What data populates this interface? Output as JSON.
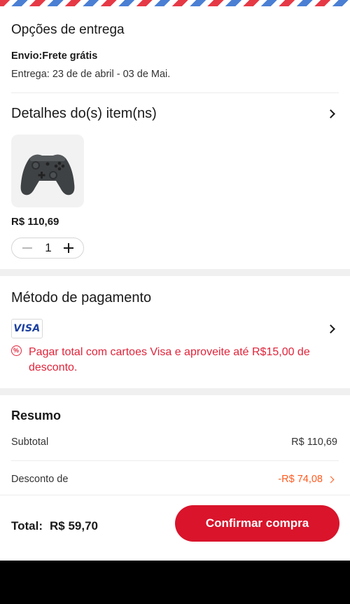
{
  "delivery": {
    "title": "Opções de entrega",
    "shipping": "Envio:Frete grátis",
    "eta": "Entrega: 23 de de abril - 03 de Mai."
  },
  "items": {
    "title": "Detalhes do(s) item(ns)",
    "product": {
      "price": "R$ 110,69",
      "quantity": "1",
      "image": "game-controller"
    }
  },
  "payment": {
    "title": "Método de pagamento",
    "card_brand": "VISA",
    "promo_icon": "%",
    "promo_text": "Pagar total  com cartoes Visa e aproveite até R$15,00 de desconto."
  },
  "summary": {
    "title": "Resumo",
    "subtotal_label": "Subtotal",
    "subtotal_value": "R$ 110,69",
    "discount_label": "Desconto de",
    "discount_value": "-R$ 74,08"
  },
  "footer": {
    "total_label": "Total:",
    "total_value": "R$ 59,70",
    "confirm_label": "Confirmar compra"
  },
  "colors": {
    "accent": "#d9142b",
    "promo": "#e0243a",
    "discount": "#ff5a1f"
  }
}
